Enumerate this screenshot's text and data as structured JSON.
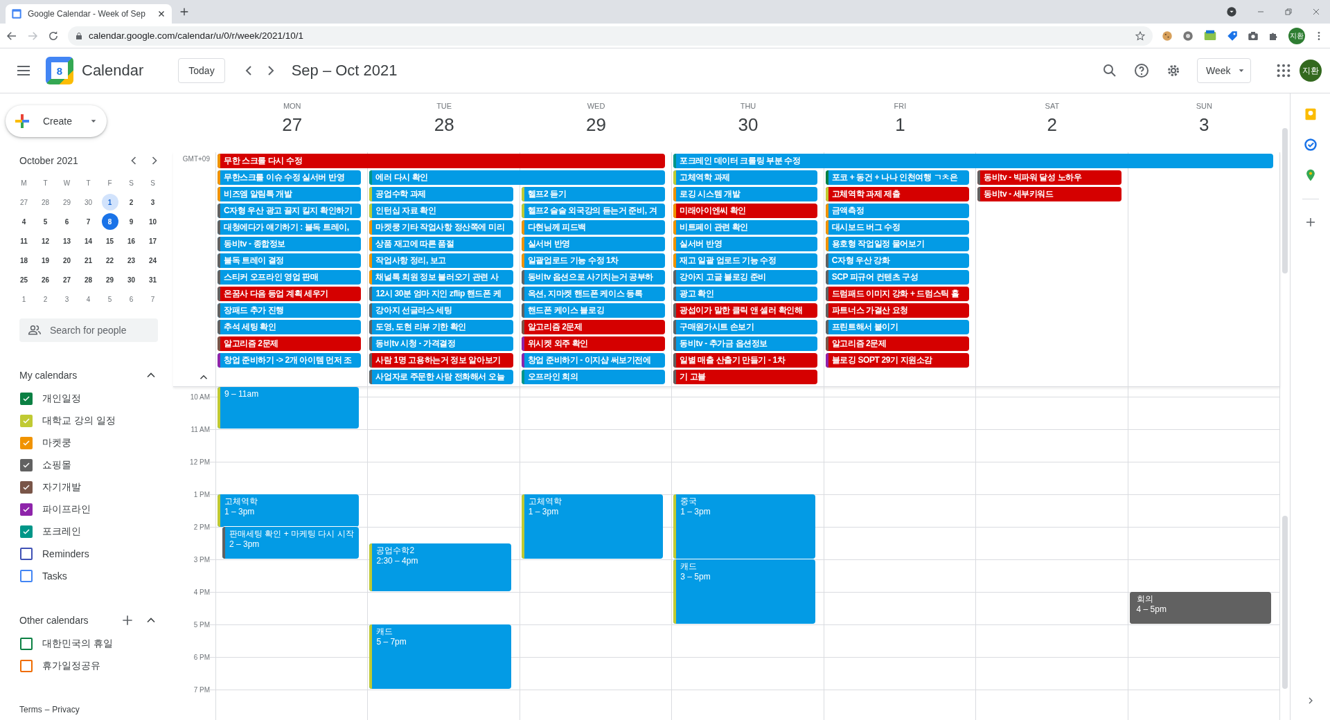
{
  "browser": {
    "tab_title": "Google Calendar - Week of Sep",
    "url": "calendar.google.com/calendar/u/0/r/week/2021/10/1",
    "profile": "지환"
  },
  "header": {
    "app_name": "Calendar",
    "logo_day": "8",
    "today_button": "Today",
    "date_range": "Sep – Oct 2021",
    "view_select": "Week",
    "avatar": "지환"
  },
  "sidebar": {
    "create_button": "Create",
    "mini_calendar": {
      "title": "October 2021",
      "weekdays": [
        "M",
        "T",
        "W",
        "T",
        "F",
        "S",
        "S"
      ],
      "weeks": [
        [
          {
            "day": "27",
            "muted": true,
            "selected": false,
            "today": false
          },
          {
            "day": "28",
            "muted": true,
            "selected": false,
            "today": false
          },
          {
            "day": "29",
            "muted": true,
            "selected": false,
            "today": false
          },
          {
            "day": "30",
            "muted": true,
            "selected": false,
            "today": false
          },
          {
            "day": "1",
            "muted": false,
            "selected": true,
            "today": false
          },
          {
            "day": "2",
            "muted": false,
            "selected": false,
            "today": false
          },
          {
            "day": "3",
            "muted": false,
            "selected": false,
            "today": false
          }
        ],
        [
          {
            "day": "4",
            "muted": false,
            "selected": false,
            "today": false
          },
          {
            "day": "5",
            "muted": false,
            "selected": false,
            "today": false
          },
          {
            "day": "6",
            "muted": false,
            "selected": false,
            "today": false
          },
          {
            "day": "7",
            "muted": false,
            "selected": false,
            "today": false
          },
          {
            "day": "8",
            "muted": false,
            "selected": false,
            "today": true
          },
          {
            "day": "9",
            "muted": false,
            "selected": false,
            "today": false
          },
          {
            "day": "10",
            "muted": false,
            "selected": false,
            "today": false
          }
        ],
        [
          {
            "day": "11",
            "muted": false,
            "selected": false,
            "today": false
          },
          {
            "day": "12",
            "muted": false,
            "selected": false,
            "today": false
          },
          {
            "day": "13",
            "muted": false,
            "selected": false,
            "today": false
          },
          {
            "day": "14",
            "muted": false,
            "selected": false,
            "today": false
          },
          {
            "day": "15",
            "muted": false,
            "selected": false,
            "today": false
          },
          {
            "day": "16",
            "muted": false,
            "selected": false,
            "today": false
          },
          {
            "day": "17",
            "muted": false,
            "selected": false,
            "today": false
          }
        ],
        [
          {
            "day": "18",
            "muted": false,
            "selected": false,
            "today": false
          },
          {
            "day": "19",
            "muted": false,
            "selected": false,
            "today": false
          },
          {
            "day": "20",
            "muted": false,
            "selected": false,
            "today": false
          },
          {
            "day": "21",
            "muted": false,
            "selected": false,
            "today": false
          },
          {
            "day": "22",
            "muted": false,
            "selected": false,
            "today": false
          },
          {
            "day": "23",
            "muted": false,
            "selected": false,
            "today": false
          },
          {
            "day": "24",
            "muted": false,
            "selected": false,
            "today": false
          }
        ],
        [
          {
            "day": "25",
            "muted": false,
            "selected": false,
            "today": false
          },
          {
            "day": "26",
            "muted": false,
            "selected": false,
            "today": false
          },
          {
            "day": "27",
            "muted": false,
            "selected": false,
            "today": false
          },
          {
            "day": "28",
            "muted": false,
            "selected": false,
            "today": false
          },
          {
            "day": "29",
            "muted": false,
            "selected": false,
            "today": false
          },
          {
            "day": "30",
            "muted": false,
            "selected": false,
            "today": false
          },
          {
            "day": "31",
            "muted": false,
            "selected": false,
            "today": false
          }
        ],
        [
          {
            "day": "1",
            "muted": true,
            "selected": false,
            "today": false
          },
          {
            "day": "2",
            "muted": true,
            "selected": false,
            "today": false
          },
          {
            "day": "3",
            "muted": true,
            "selected": false,
            "today": false
          },
          {
            "day": "4",
            "muted": true,
            "selected": false,
            "today": false
          },
          {
            "day": "5",
            "muted": true,
            "selected": false,
            "today": false
          },
          {
            "day": "6",
            "muted": true,
            "selected": false,
            "today": false
          },
          {
            "day": "7",
            "muted": true,
            "selected": false,
            "today": false
          }
        ]
      ]
    },
    "search": {
      "placeholder": "Search for people"
    },
    "my_calendars": {
      "title": "My calendars",
      "items": [
        {
          "name": "개인일정",
          "color": "#0b8043",
          "checked": true
        },
        {
          "name": "대학교 강의 일정",
          "color": "#c0ca33",
          "checked": true
        },
        {
          "name": "마켓쿵",
          "color": "#f09300",
          "checked": true
        },
        {
          "name": "쇼핑몰",
          "color": "#616161",
          "checked": true
        },
        {
          "name": "자기개발",
          "color": "#795548",
          "checked": true
        },
        {
          "name": "파이프라인",
          "color": "#8e24aa",
          "checked": true
        },
        {
          "name": "포크레인",
          "color": "#009688",
          "checked": true
        },
        {
          "name": "Reminders",
          "color": "#3f51b5",
          "checked": false
        },
        {
          "name": "Tasks",
          "color": "#4285f4",
          "checked": false
        }
      ]
    },
    "other_calendars": {
      "title": "Other calendars",
      "items": [
        {
          "name": "대한민국의 휴일",
          "color": "#0b8043",
          "checked": false
        },
        {
          "name": "휴가일정공유",
          "color": "#ef6c00",
          "checked": false
        }
      ]
    },
    "footer": {
      "terms": "Terms",
      "separator": "–",
      "privacy": "Privacy"
    }
  },
  "week": {
    "timezone": "GMT+09",
    "days": [
      {
        "name": "MON",
        "date": "27",
        "events": [
          {
            "time": "9 – 11am",
            "color": "#039be5",
            "calendar": {
              "color": "#c0ca33"
            },
            "overlapping": false
          },
          {
            "title": "고체역학",
            "time": "1 – 3pm",
            "color": "#039be5",
            "calendar": {
              "color": "#c0ca33"
            },
            "overlapping": false
          },
          {
            "title": "판매세팅 확인 + 마케팅 다시 시작",
            "time": "2 – 3pm",
            "color": "#039be5",
            "calendar": {
              "color": "#616161"
            },
            "overlapping": true
          }
        ]
      },
      {
        "name": "TUE",
        "date": "28",
        "events": [
          {
            "title": "공업수학2",
            "time": "2:30 – 4pm",
            "color": "#039be5",
            "calendar": {
              "color": "#c0ca33"
            },
            "overlapping": false
          },
          {
            "title": "캐드",
            "time": "5 – 7pm",
            "color": "#039be5",
            "calendar": {
              "color": "#c0ca33"
            },
            "overlapping": false
          }
        ]
      },
      {
        "name": "WED",
        "date": "29",
        "events": [
          {
            "title": "고체역학",
            "time": "1 – 3pm",
            "color": "#039be5",
            "calendar": {
              "color": "#c0ca33"
            },
            "overlapping": false
          }
        ]
      },
      {
        "name": "THU",
        "date": "30",
        "events": [
          {
            "title": "중국",
            "time": "1 – 3pm",
            "color": "#039be5",
            "calendar": {
              "color": "#c0ca33"
            },
            "overlapping": false
          },
          {
            "title": "캐드",
            "time": "3 – 5pm",
            "color": "#039be5",
            "calendar": {
              "color": "#c0ca33"
            },
            "overlapping": false
          }
        ]
      },
      {
        "name": "FRI",
        "date": "1"
      },
      {
        "name": "SAT",
        "date": "2"
      },
      {
        "name": "SUN",
        "date": "3",
        "events": [
          {
            "title": "회의",
            "time": "4 – 5pm",
            "color": "#616161",
            "calendar": {
              "color": "#616161"
            },
            "overlapping": false
          }
        ]
      }
    ],
    "all_day_rows": [
      [
        {
          "kind": "event",
          "title": "무한 스크롤 다시 수정",
          "color": "#d50000",
          "calendar": {
            "color": "#f09300"
          }
        },
        {
          "kind": "continued"
        },
        {
          "kind": "continued"
        },
        {
          "kind": "event",
          "title": "포크레인 데이터 크롤링 부분 수정",
          "color": "#039be5",
          "calendar": {
            "color": "#009688"
          }
        },
        {
          "kind": "continued"
        },
        {
          "kind": "continued"
        },
        {
          "kind": "continued"
        }
      ],
      [
        {
          "kind": "event",
          "title": "무한스크롤 이슈 수정 실서버 반영",
          "color": "#039be5",
          "calendar": {
            "color": "#f09300"
          }
        },
        {
          "kind": "event",
          "title": "에러 다시 확인",
          "color": "#039be5",
          "calendar": {
            "color": "#009688"
          }
        },
        {
          "kind": "continued"
        },
        {
          "kind": "event",
          "title": "고체역학 과제",
          "color": "#039be5",
          "calendar": {
            "color": "#c0ca33"
          }
        },
        {
          "kind": "event",
          "title": "포코 + 동건 + 나나 인천여행 ㄱㅊ은",
          "color": "#039be5",
          "calendar": {
            "color": "#0b8043"
          }
        },
        {
          "kind": "event",
          "title": "동비tv - 빅파워 달성 노하우",
          "color": "#d50000",
          "calendar": {
            "color": "#616161"
          }
        },
        {
          "kind": "empty"
        }
      ],
      [
        {
          "kind": "event",
          "title": "비즈엠 알림톡 개발",
          "color": "#039be5",
          "calendar": {
            "color": "#f09300"
          }
        },
        {
          "kind": "event",
          "title": "공업수학 과제",
          "color": "#039be5",
          "calendar": {
            "color": "#c0ca33"
          }
        },
        {
          "kind": "event",
          "title": "헬프2 듣기",
          "color": "#039be5",
          "calendar": {
            "color": "#c0ca33"
          }
        },
        {
          "kind": "event",
          "title": "로깅 시스템 개발",
          "color": "#039be5",
          "calendar": {
            "color": "#f09300"
          }
        },
        {
          "kind": "event",
          "title": "고체역학 과제 제출",
          "color": "#d50000",
          "calendar": {
            "color": "#c0ca33"
          }
        },
        {
          "kind": "event",
          "title": "동비tv - 세부키워드",
          "color": "#d50000",
          "calendar": {
            "color": "#616161"
          }
        },
        {
          "kind": "empty"
        }
      ],
      [
        {
          "kind": "event",
          "title": "C자형 우산 광고 끌지 킬지 확인하기",
          "color": "#039be5",
          "calendar": {
            "color": "#616161"
          }
        },
        {
          "kind": "event",
          "title": "인턴십 자료 확인",
          "color": "#039be5",
          "calendar": {
            "color": "#c0ca33"
          }
        },
        {
          "kind": "event",
          "title": "헬프2 슬슬 외국강의 듣는거 준비, 겨",
          "color": "#039be5",
          "calendar": {
            "color": "#c0ca33"
          }
        },
        {
          "kind": "event",
          "title": "미래아이엔씨 확인",
          "color": "#d50000",
          "calendar": {
            "color": "#f09300"
          }
        },
        {
          "kind": "event",
          "title": "금액측정",
          "color": "#039be5",
          "calendar": {
            "color": "#f09300"
          }
        },
        {
          "kind": "empty"
        },
        {
          "kind": "empty"
        }
      ],
      [
        {
          "kind": "event",
          "title": "대청에다가 얘기하기 : 불독 트레이,",
          "color": "#039be5",
          "calendar": {
            "color": "#616161"
          }
        },
        {
          "kind": "event",
          "title": "마켓쿵 기타 작업사항 정산쪽에 미리",
          "color": "#039be5",
          "calendar": {
            "color": "#f09300"
          }
        },
        {
          "kind": "event",
          "title": "다현님께 피드백",
          "color": "#039be5",
          "calendar": {
            "color": "#f09300"
          }
        },
        {
          "kind": "event",
          "title": "비트페이 관련 확인",
          "color": "#039be5",
          "calendar": {
            "color": "#f09300"
          }
        },
        {
          "kind": "event",
          "title": "대시보드 버그 수정",
          "color": "#039be5",
          "calendar": {
            "color": "#f09300"
          }
        },
        {
          "kind": "empty"
        },
        {
          "kind": "empty"
        }
      ],
      [
        {
          "kind": "event",
          "title": "동비tv - 종합정보",
          "color": "#039be5",
          "calendar": {
            "color": "#616161"
          }
        },
        {
          "kind": "event",
          "title": "상품 재고에 따른 품절",
          "color": "#039be5",
          "calendar": {
            "color": "#f09300"
          }
        },
        {
          "kind": "event",
          "title": "실서버 반영",
          "color": "#039be5",
          "calendar": {
            "color": "#f09300"
          }
        },
        {
          "kind": "event",
          "title": "실서버 반영",
          "color": "#039be5",
          "calendar": {
            "color": "#f09300"
          }
        },
        {
          "kind": "event",
          "title": "용호형 작업일정 물어보기",
          "color": "#039be5",
          "calendar": {
            "color": "#f09300"
          }
        },
        {
          "kind": "empty"
        },
        {
          "kind": "empty"
        }
      ],
      [
        {
          "kind": "event",
          "title": "불독 트레이 결정",
          "color": "#039be5",
          "calendar": {
            "color": "#616161"
          }
        },
        {
          "kind": "event",
          "title": "작업사항 정리, 보고",
          "color": "#039be5",
          "calendar": {
            "color": "#f09300"
          }
        },
        {
          "kind": "event",
          "title": "일괄업로드 기능 수정 1차",
          "color": "#039be5",
          "calendar": {
            "color": "#f09300"
          }
        },
        {
          "kind": "event",
          "title": "재고 일괄 업로드 기능 수정",
          "color": "#039be5",
          "calendar": {
            "color": "#f09300"
          }
        },
        {
          "kind": "event",
          "title": "C자형 우산 강화",
          "color": "#039be5",
          "calendar": {
            "color": "#616161"
          }
        },
        {
          "kind": "empty"
        },
        {
          "kind": "empty"
        }
      ],
      [
        {
          "kind": "event",
          "title": "스티커 오프라인 영업 판매",
          "color": "#039be5",
          "calendar": {
            "color": "#616161"
          }
        },
        {
          "kind": "event",
          "title": "채널톡 회원 정보 불러오기 관련 사",
          "color": "#039be5",
          "calendar": {
            "color": "#f09300"
          }
        },
        {
          "kind": "event",
          "title": "동비tv 옵션으로 사기치는거 공부하",
          "color": "#039be5",
          "calendar": {
            "color": "#616161"
          }
        },
        {
          "kind": "event",
          "title": "강아지 고글 블로깅 준비",
          "color": "#039be5",
          "calendar": {
            "color": "#616161"
          }
        },
        {
          "kind": "event",
          "title": "SCP 피규어 컨텐츠 구성",
          "color": "#039be5",
          "calendar": {
            "color": "#616161"
          }
        },
        {
          "kind": "empty"
        },
        {
          "kind": "empty"
        }
      ],
      [
        {
          "kind": "event",
          "title": "온꿈사 다음 등업 계획 세우기",
          "color": "#d50000",
          "calendar": {
            "color": "#616161"
          }
        },
        {
          "kind": "event",
          "title": "12시 30분 엄마 지인 zflip 핸드폰 케",
          "color": "#039be5",
          "calendar": {
            "color": "#616161"
          }
        },
        {
          "kind": "event",
          "title": "옥션, 지마켓 핸드폰 케이스 등록",
          "color": "#039be5",
          "calendar": {
            "color": "#616161"
          }
        },
        {
          "kind": "event",
          "title": "광고 확인",
          "color": "#039be5",
          "calendar": {
            "color": "#616161"
          }
        },
        {
          "kind": "event",
          "title": "드럼패드 이미지 강화 + 드럼스틱 홀",
          "color": "#d50000",
          "calendar": {
            "color": "#616161"
          }
        },
        {
          "kind": "empty"
        },
        {
          "kind": "empty"
        }
      ],
      [
        {
          "kind": "event",
          "title": "장패드 추가 진행",
          "color": "#039be5",
          "calendar": {
            "color": "#616161"
          }
        },
        {
          "kind": "event",
          "title": "강아지 선글라스 세팅",
          "color": "#039be5",
          "calendar": {
            "color": "#616161"
          }
        },
        {
          "kind": "event",
          "title": "핸드폰 케이스 블로깅",
          "color": "#039be5",
          "calendar": {
            "color": "#616161"
          }
        },
        {
          "kind": "event",
          "title": "광섭이가 말한 클릭 앤 셀러 확인해",
          "color": "#d50000",
          "calendar": {
            "color": "#616161"
          }
        },
        {
          "kind": "event",
          "title": "파트너스 가결산 요청",
          "color": "#d50000",
          "calendar": {
            "color": "#616161"
          }
        },
        {
          "kind": "empty"
        },
        {
          "kind": "empty"
        }
      ],
      [
        {
          "kind": "event",
          "title": "추석 세팅 확인",
          "color": "#039be5",
          "calendar": {
            "color": "#616161"
          }
        },
        {
          "kind": "event",
          "title": "도영, 도현 리뷰 기한 확인",
          "color": "#039be5",
          "calendar": {
            "color": "#616161"
          }
        },
        {
          "kind": "event",
          "title": "알고리즘 2문제",
          "color": "#d50000",
          "calendar": {
            "color": "#795548"
          }
        },
        {
          "kind": "event",
          "title": "구매원가시트 손보기",
          "color": "#039be5",
          "calendar": {
            "color": "#616161"
          }
        },
        {
          "kind": "event",
          "title": "프린트해서 붙이기",
          "color": "#039be5",
          "calendar": {
            "color": "#616161"
          }
        },
        {
          "kind": "empty"
        },
        {
          "kind": "empty"
        }
      ],
      [
        {
          "kind": "event",
          "title": "알고리즘 2문제",
          "color": "#d50000",
          "calendar": {
            "color": "#795548"
          }
        },
        {
          "kind": "event",
          "title": "동비tv 시청 - 가격결정",
          "color": "#039be5",
          "calendar": {
            "color": "#616161"
          }
        },
        {
          "kind": "event",
          "title": "위시켓 외주 확인",
          "color": "#d50000",
          "calendar": {
            "color": "#8e24aa"
          }
        },
        {
          "kind": "event",
          "title": "동비tv - 추가금 옵션정보",
          "color": "#039be5",
          "calendar": {
            "color": "#616161"
          }
        },
        {
          "kind": "event",
          "title": "알고리즘 2문제",
          "color": "#d50000",
          "calendar": {
            "color": "#795548"
          }
        },
        {
          "kind": "empty"
        },
        {
          "kind": "empty"
        }
      ],
      [
        {
          "kind": "event",
          "title": "창업 준비하기 -> 2개 아이템 먼저 조",
          "color": "#039be5",
          "calendar": {
            "color": "#8e24aa"
          }
        },
        {
          "kind": "event",
          "title": "사람 1명 고용하는거 정보 알아보기",
          "color": "#d50000",
          "calendar": {
            "color": "#616161"
          }
        },
        {
          "kind": "event",
          "title": "창업 준비하기 - 이지샵 써보기전에",
          "color": "#039be5",
          "calendar": {
            "color": "#8e24aa"
          }
        },
        {
          "kind": "event",
          "title": "일별 매출 산출기 만들기 - 1차",
          "color": "#d50000",
          "calendar": {
            "color": "#616161"
          }
        },
        {
          "kind": "event",
          "title": "블로깅 SOPT 29기 지원소감",
          "color": "#d50000",
          "calendar": {
            "color": "#8e24aa"
          }
        },
        {
          "kind": "empty"
        },
        {
          "kind": "empty"
        }
      ],
      [
        {
          "kind": "empty"
        },
        {
          "kind": "event",
          "title": "사업자로 주문한 사람 전화해서 오늘",
          "color": "#039be5",
          "calendar": {
            "color": "#616161"
          }
        },
        {
          "kind": "event",
          "title": "오프라인 회의",
          "color": "#039be5",
          "calendar": {
            "color": "#009688"
          }
        },
        {
          "kind": "event",
          "title": "기 고블",
          "color": "#d50000",
          "calendar": {
            "color": "#616161"
          }
        },
        {
          "kind": "empty"
        },
        {
          "kind": "empty"
        },
        {
          "kind": "empty"
        }
      ]
    ],
    "hours": [
      "10 AM",
      "11 AM",
      "12 PM",
      "1 PM",
      "2 PM",
      "3 PM",
      "4 PM",
      "5 PM",
      "6 PM",
      "7 PM"
    ]
  }
}
